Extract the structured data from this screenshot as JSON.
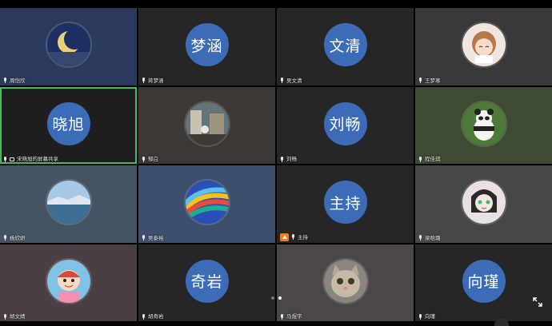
{
  "participants": [
    {
      "label": "周恺欣",
      "avatar_text": "",
      "avatar_kind": "moon",
      "speaking": false,
      "sharing": false,
      "host": false
    },
    {
      "label": "蒋梦涵",
      "avatar_text": "梦涵",
      "avatar_kind": "text",
      "speaking": false,
      "sharing": false,
      "host": false
    },
    {
      "label": "吴文清",
      "avatar_text": "文清",
      "avatar_kind": "text",
      "speaking": false,
      "sharing": false,
      "host": false
    },
    {
      "label": "王梦寒",
      "avatar_text": "",
      "avatar_kind": "anime-girl",
      "speaking": false,
      "sharing": false,
      "host": false
    },
    {
      "label": "宋晓旭的屏幕共享",
      "avatar_text": "晓旭",
      "avatar_kind": "text",
      "speaking": true,
      "sharing": true,
      "host": false
    },
    {
      "label": "郁白",
      "avatar_text": "",
      "avatar_kind": "street",
      "speaking": false,
      "sharing": false,
      "host": false
    },
    {
      "label": "刘畅",
      "avatar_text": "刘畅",
      "avatar_kind": "text",
      "speaking": false,
      "sharing": false,
      "host": false
    },
    {
      "label": "程佳琪",
      "avatar_text": "",
      "avatar_kind": "panda",
      "speaking": false,
      "sharing": false,
      "host": false
    },
    {
      "label": "杨欣妍",
      "avatar_text": "",
      "avatar_kind": "lake",
      "speaking": false,
      "sharing": false,
      "host": false
    },
    {
      "label": "吴泰裕",
      "avatar_text": "",
      "avatar_kind": "rainbow",
      "speaking": false,
      "sharing": false,
      "host": false
    },
    {
      "label": "主持",
      "avatar_text": "主持",
      "avatar_kind": "text",
      "speaking": false,
      "sharing": false,
      "host": true
    },
    {
      "label": "梁晗璐",
      "avatar_text": "",
      "avatar_kind": "cartoon-girl",
      "speaking": false,
      "sharing": false,
      "host": false
    },
    {
      "label": "胡文婧",
      "avatar_text": "",
      "avatar_kind": "cartoon-kid",
      "speaking": false,
      "sharing": false,
      "host": false
    },
    {
      "label": "胡奇岩",
      "avatar_text": "奇岩",
      "avatar_kind": "text",
      "speaking": false,
      "sharing": false,
      "host": false
    },
    {
      "label": "马煜宇",
      "avatar_text": "",
      "avatar_kind": "cat",
      "speaking": false,
      "sharing": false,
      "host": false
    },
    {
      "label": "向瑾",
      "avatar_text": "向瑾",
      "avatar_kind": "text",
      "speaking": false,
      "sharing": false,
      "host": false
    }
  ],
  "tile_backgrounds": [
    "#2b3a5c",
    "#262626",
    "#262626",
    "#3a3838",
    "#1f1f1f",
    "#3b3835",
    "#262626",
    "#3e4a32",
    "#445463",
    "#3e4f6d",
    "#262626",
    "#474747",
    "#4a3f45",
    "#262626",
    "#4a4746",
    "#262626"
  ],
  "pagination": {
    "pages": 2,
    "current": 1
  },
  "colors": {
    "avatar_blue": "#3c6bb8",
    "speaking_border": "#3cc05c",
    "host_badge": "#f07a1c"
  }
}
